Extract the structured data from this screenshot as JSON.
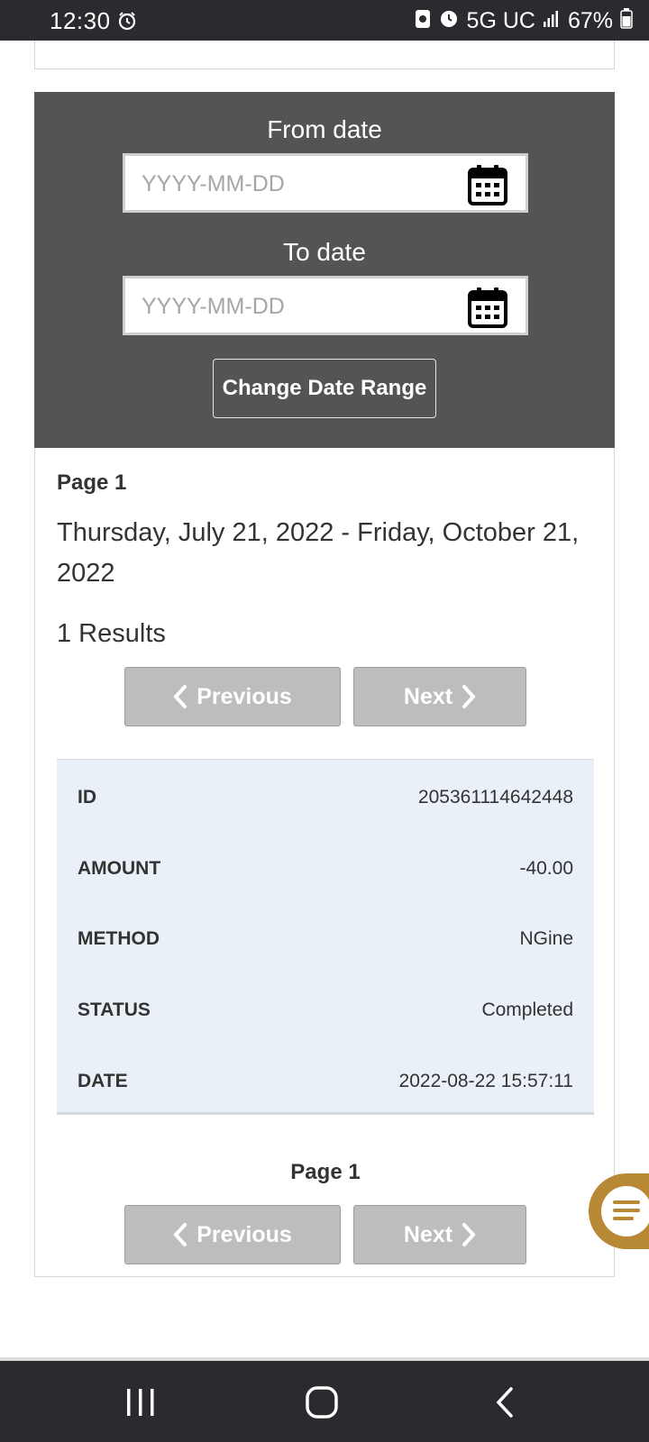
{
  "status_bar": {
    "time": "12:30",
    "network": "5G UC",
    "battery": "67%"
  },
  "filter": {
    "from_label": "From date",
    "from_placeholder": "YYYY-MM-DD",
    "to_label": "To date",
    "to_placeholder": "YYYY-MM-DD",
    "change_button": "Change Date Range"
  },
  "results": {
    "page_label": "Page 1",
    "date_range": "Thursday, July 21, 2022 - Friday, October 21, 2022",
    "count": "1 Results",
    "prev_label": "Previous",
    "next_label": "Next",
    "rows": [
      {
        "key": "ID",
        "value": "205361114642448"
      },
      {
        "key": "AMOUNT",
        "value": "-40.00"
      },
      {
        "key": "METHOD",
        "value": "NGine"
      },
      {
        "key": "STATUS",
        "value": "Completed"
      },
      {
        "key": "DATE",
        "value": "2022-08-22 15:57:11"
      }
    ],
    "bottom_page_label": "Page 1"
  },
  "colors": {
    "panel_bg": "#545454",
    "table_bg": "#e9f0f8",
    "button_disabled": "#bdbdbd",
    "chat_accent": "#b78934"
  },
  "icons": [
    "alarm-icon",
    "calendar-icon",
    "chevron-left-icon",
    "chevron-right-icon",
    "chat-icon",
    "recents-icon",
    "home-icon",
    "back-icon"
  ]
}
